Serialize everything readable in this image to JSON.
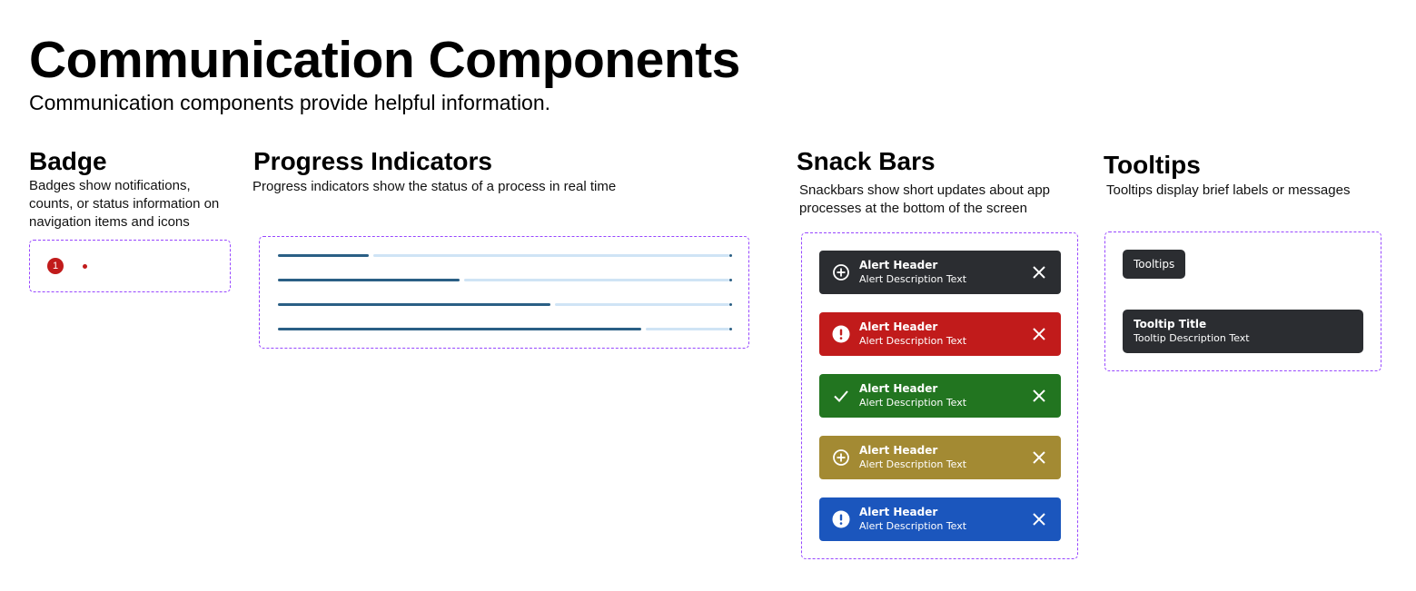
{
  "page": {
    "title": "Communication Components",
    "subtitle": "Communication components provide helpful information."
  },
  "badge": {
    "title": "Badge",
    "description": "Badges show notifications, counts, or status information on navigation items and icons",
    "count": "1",
    "color": "#c11b1b"
  },
  "progress": {
    "title": "Progress Indicators",
    "description": "Progress indicators show the status of a process in real time",
    "fill_color": "#2a5f85",
    "track_color": "#cfe4f5",
    "values": [
      0.2,
      0.4,
      0.6,
      0.8
    ]
  },
  "snackbars": {
    "title": "Snack Bars",
    "description": "Snackbars show short updates about app processes at the bottom of the screen",
    "items": [
      {
        "header": "Alert Header",
        "description": "Alert Description Text",
        "color": "#2b2d31",
        "icon": "plus-circle-icon"
      },
      {
        "header": "Alert Header",
        "description": "Alert Description Text",
        "color": "#c11b1b",
        "icon": "exclamation-circle-icon"
      },
      {
        "header": "Alert Header",
        "description": "Alert Description Text",
        "color": "#227520",
        "icon": "checkmark-icon"
      },
      {
        "header": "Alert Header",
        "description": "Alert Description Text",
        "color": "#a38a33",
        "icon": "plus-circle-icon"
      },
      {
        "header": "Alert Header",
        "description": "Alert Description Text",
        "color": "#1b56bd",
        "icon": "exclamation-circle-icon"
      }
    ]
  },
  "tooltips": {
    "title": "Tooltips",
    "description": "Tooltips display brief labels or messages",
    "simple_label": "Tooltips",
    "rich_title": "Tooltip Title",
    "rich_description": "Tooltip Description Text",
    "color": "#2b2d31"
  }
}
